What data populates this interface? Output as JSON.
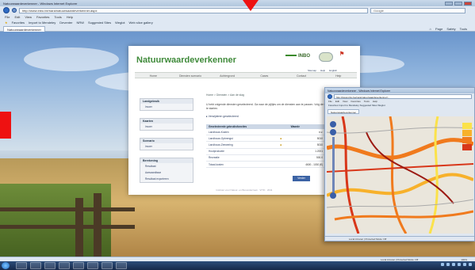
{
  "browser": {
    "title": "Natuurwaardeverkenner - Windows Internet Explorer",
    "url": "http://www.inbo.be/nara/natuurwaardeverkenner.aspx",
    "search_placeholder": "Google",
    "menu": [
      "File",
      "Edit",
      "View",
      "Favorites",
      "Tools",
      "Help"
    ],
    "favorites_label": "Favorites",
    "favorites": [
      "Import to Mendeley",
      "Deventer",
      "NRW",
      "Suggested Sites",
      "Weglot",
      "Web slice gallery"
    ],
    "tab": "Natuurwaardeverkenner",
    "tools": [
      "Page",
      "Safety",
      "Tools"
    ],
    "status_zone": "Local intranet | Protected Mode: Off",
    "zoom": "100%"
  },
  "page": {
    "brand": "Natuurwaardeverkenner",
    "inbo": "INBO",
    "util_links": [
      "Sitemap",
      "Help",
      "English"
    ],
    "nav": [
      "Home",
      "Diensten scenario",
      "Achtergrond",
      "Cases",
      "Contact",
      "Help"
    ],
    "breadcrumb": "Home > Diensten > Aan de slag",
    "intro": "U hebt volgende diensten geselecteerd. Ga naar de pijltjes om de diensten aan te passen. Volg de stappen om de berekening te starten.",
    "intro_link": "Verwijderen geselecteerd",
    "sidebar": [
      {
        "header": "Landgebruik",
        "item": "Invoer"
      },
      {
        "header": "Kaarten",
        "item": "Invoer"
      },
      {
        "header": "Scenario",
        "item": "Invoer"
      },
      {
        "header": "Berekening",
        "items": [
          "Resultaat",
          "Aanvaardbaar",
          "Resultaat exporteren"
        ]
      }
    ],
    "table": {
      "headers": [
        "Geselecteerde gebruiksfuncties",
        "Waarde"
      ],
      "rows": [
        {
          "name": "Landbouw-Kosten",
          "locked": false,
          "value": "n.v."
        },
        {
          "name": "Landbouw-Opbrengst",
          "locked": true,
          "value": "5010"
        },
        {
          "name": "Landbouw-Zeewering",
          "locked": true,
          "value": "5010"
        },
        {
          "name": "Houtproductie",
          "locked": false,
          "value": "1.2001"
        },
        {
          "name": "Recreatie",
          "locked": false,
          "value": "500.0"
        },
        {
          "name": "Totaal-kosten",
          "locked": false,
          "value": "4600 - 1030 (€)"
        }
      ]
    },
    "button": "Verder",
    "footer": "Instituut voor Natuur- en Bosonderzoek · VITO · 2011"
  },
  "map_window": {
    "title": "Natuurwaardeverkenner - Windows Internet Explorer",
    "url": "http://www.inbo.be/nara/natuurwaardeverkenner/...",
    "menu": [
      "File",
      "Edit",
      "View",
      "Favorites",
      "Tools",
      "Help"
    ],
    "favorites": "Favorites  Import to Mendeley  Suggested Sites  Weglot",
    "tab": "Natuurwaardeverkenner",
    "status": "Local intranet | Protected Mode: Off"
  },
  "colors": {
    "brand_green": "#3f8a3a",
    "button_blue": "#3c63a5",
    "marker_red": "#ee1111",
    "legend": [
      "#fbe24a",
      "#f7b12b",
      "#f07a1d",
      "#d8371a",
      "#9c1a13"
    ]
  }
}
